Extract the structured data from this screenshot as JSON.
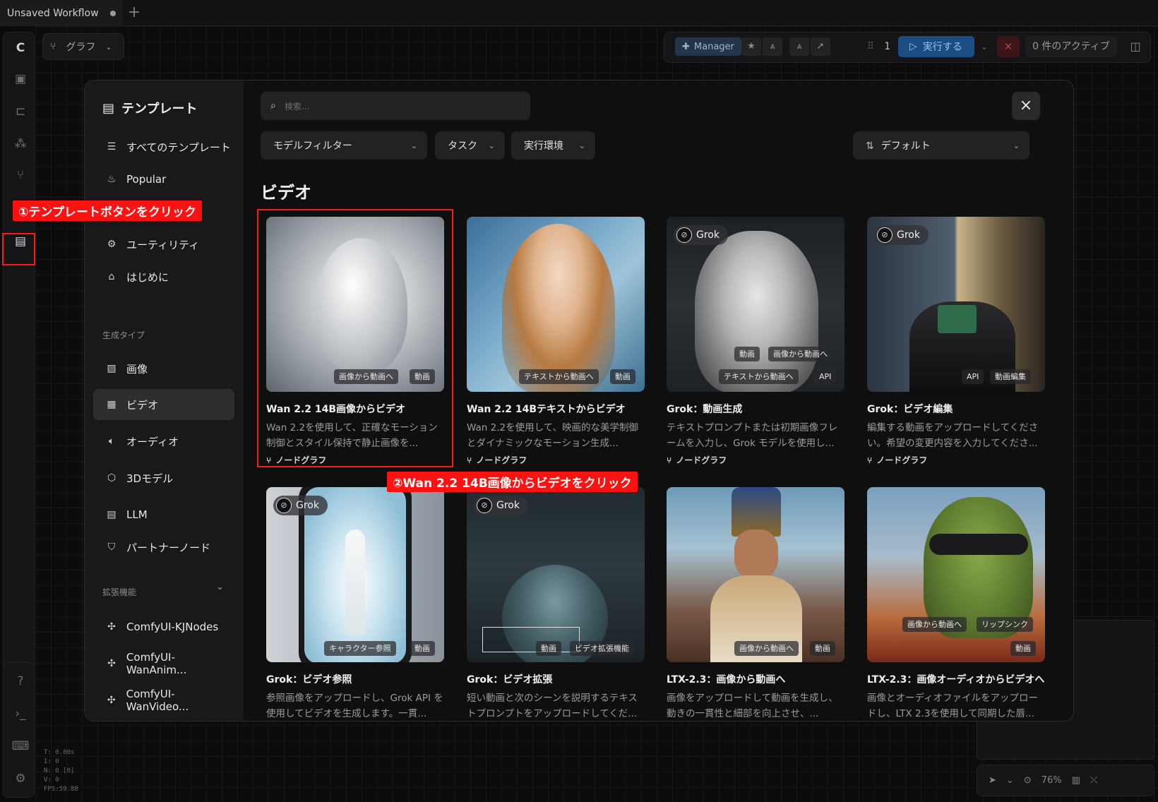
{
  "tab": {
    "title": "Unsaved Workflow",
    "plus": "+"
  },
  "graph_button": {
    "label": "グラフ"
  },
  "toolbar": {
    "manager": "Manager",
    "queue_count": "1",
    "run": "実行する",
    "active": "0 件のアクティブ"
  },
  "stats": {
    "lines": [
      "T: 0.00s",
      "I: 0",
      "N: 0 [0]",
      "V: 0",
      "FPS:59.88"
    ]
  },
  "zoom": {
    "value": "76%"
  },
  "modal": {
    "title": "テンプレート",
    "search_placeholder": "検索...",
    "nav": [
      {
        "label": "すべてのテンプレート",
        "icon": "list-icon"
      },
      {
        "label": "Popular",
        "icon": "flame-icon"
      },
      {
        "label": "ユーティリティ",
        "icon": "gear-icon"
      },
      {
        "label": "はじめに",
        "icon": "graduation-cap-icon"
      }
    ],
    "section_generation": "生成タイプ",
    "gen_types": [
      {
        "label": "画像",
        "icon": "image-icon"
      },
      {
        "label": "ビデオ",
        "icon": "film-icon",
        "selected": true
      },
      {
        "label": "オーディオ",
        "icon": "speaker-icon"
      },
      {
        "label": "3Dモデル",
        "icon": "cube-icon"
      },
      {
        "label": "LLM",
        "icon": "chat-icon"
      },
      {
        "label": "パートナーノード",
        "icon": "handshake-icon"
      }
    ],
    "section_extensions": "拡張機能",
    "extensions": [
      {
        "label": "ComfyUI-KJNodes"
      },
      {
        "label": "ComfyUI-WanAnim..."
      },
      {
        "label": "ComfyUI-WanVideo..."
      }
    ],
    "filters": {
      "model": "モデルフィルター",
      "task": "タスク",
      "runtime": "実行環境",
      "sort": "デフォルト"
    },
    "category_title": "ビデオ",
    "cards": [
      {
        "title": "Wan 2.2 14B画像からビデオ",
        "desc": "Wan 2.2を使用して、正確なモーション制御とスタイル保持で静止画像を...",
        "foot": "ノードグラフ",
        "tags": [
          "画像から動画へ",
          "動画"
        ],
        "grok": ""
      },
      {
        "title": "Wan 2.2 14Bテキストからビデオ",
        "desc": "Wan 2.2を使用して、映画的な美学制御とダイナミックなモーション生成...",
        "foot": "ノードグラフ",
        "tags": [
          "テキストから動画へ",
          "動画"
        ],
        "grok": ""
      },
      {
        "title": "Grok：動画生成",
        "desc": "テキストプロンプトまたは初期画像フレームを入力し、Grok モデルを使用し...",
        "foot": "ノードグラフ",
        "tags": [
          "動画",
          "画像から動画へ",
          "テキストから動画へ",
          "API"
        ],
        "grok": "Grok"
      },
      {
        "title": "Grok：ビデオ編集",
        "desc": "編集する動画をアップロードしてください。希望の変更内容を入力してくださ...",
        "foot": "ノードグラフ",
        "tags": [
          "API",
          "動画編集"
        ],
        "grok": "Grok"
      },
      {
        "title": "Grok：ビデオ参照",
        "desc": "参照画像をアップロードし、Grok API を使用してビデオを生成します。一貫...",
        "foot": "",
        "tags": [
          "キャラクター参照",
          "動画"
        ],
        "grok": "Grok"
      },
      {
        "title": "Grok：ビデオ拡張",
        "desc": "短い動画と次のシーンを説明するテキストプロンプトをアップロードしてくだ...",
        "foot": "",
        "tags": [
          "動画",
          "ビデオ拡張機能"
        ],
        "grok": "Grok"
      },
      {
        "title": "LTX-2.3：画像から動画へ",
        "desc": "画像をアップロードして動画を生成し、動きの一貫性と細部を向上させ、...",
        "foot": "",
        "tags": [
          "画像から動画へ",
          "動画"
        ],
        "grok": ""
      },
      {
        "title": "LTX-2.3：画像オーディオからビデオへ",
        "desc": "画像とオーディオファイルをアップロードし、LTX 2.3を使用して同期した唇...",
        "foot": "",
        "tags": [
          "画像から動画へ",
          "リップシンク",
          "動画"
        ],
        "grok": ""
      }
    ]
  },
  "annotations": {
    "step1": "①テンプレートボタンをクリック",
    "step2": "②Wan 2.2 14B画像からビデオをクリック"
  }
}
